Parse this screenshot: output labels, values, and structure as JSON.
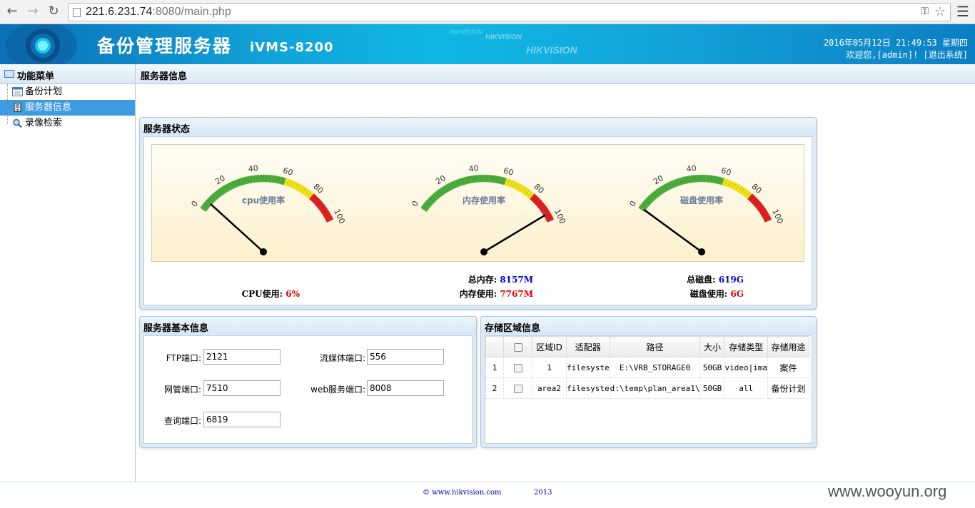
{
  "browser": {
    "url_host": "221.6.231.74",
    "url_rest": ":8080/main.php"
  },
  "header": {
    "title": "备份管理服务器",
    "model": "iVMS-8200",
    "brand": "HIKVISION",
    "datetime": "2016年05月12日 21:49:53 星期四",
    "welcome": "欢迎您,[admin]! [退出系统]"
  },
  "sidebar": {
    "title": "功能菜单",
    "items": [
      {
        "label": "备份计划"
      },
      {
        "label": "服务器信息"
      },
      {
        "label": "录像检索"
      }
    ]
  },
  "main": {
    "title": "服务器信息",
    "status_panel": {
      "title": "服务器状态",
      "gauges": [
        {
          "label": "cpu使用率",
          "value": 6
        },
        {
          "label": "内存使用率",
          "value": 95
        },
        {
          "label": "磁盘使用率",
          "value": 1
        }
      ],
      "gauge_ticks": [
        "0",
        "20",
        "40",
        "60",
        "80",
        "100"
      ],
      "cpu_label": "CPU使用:",
      "cpu_value": "6%",
      "mem_total_label": "总内存:",
      "mem_total_value": "8157M",
      "mem_used_label": "内存使用:",
      "mem_used_value": "7767M",
      "disk_total_label": "总磁盘:",
      "disk_total_value": "619G",
      "disk_used_label": "磁盘使用:",
      "disk_used_value": "6G"
    },
    "basic_panel": {
      "title": "服务器基本信息",
      "fields": {
        "ftp_label": "FTP端口:",
        "ftp_value": "2121",
        "stream_label": "流媒体端口:",
        "stream_value": "556",
        "net_label": "网管端口:",
        "net_value": "7510",
        "web_label": "web服务端口:",
        "web_value": "8008",
        "query_label": "查询端口:",
        "query_value": "6819"
      }
    },
    "storage_panel": {
      "title": "存储区域信息",
      "columns": [
        "",
        "",
        "区域ID",
        "适配器",
        "路径",
        "大小",
        "存储类型",
        "存储用途"
      ],
      "rows": [
        {
          "num": "1",
          "id": "1",
          "adapter": "filesyste",
          "path": "E:\\VRB_STORAGE0",
          "size": "50GB",
          "type": "video|ima",
          "use": "案件"
        },
        {
          "num": "2",
          "id": "area2",
          "adapter": "filesyste",
          "path": "d:\\temp\\plan_area1\\",
          "size": "50GB",
          "type": "all",
          "use": "备份计划"
        }
      ]
    }
  },
  "footer": {
    "copyright": "© www.hikvision.com",
    "year": "2013",
    "watermark": "www.wooyun.org"
  },
  "colors": {
    "header_blue": "#11a3d8",
    "active_item": "#3f9be0",
    "gauge_green": "#4caf3c",
    "gauge_yellow": "#f2e31a",
    "gauge_red": "#e02020",
    "value_red": "#e00000",
    "value_blue": "#0000e0"
  }
}
